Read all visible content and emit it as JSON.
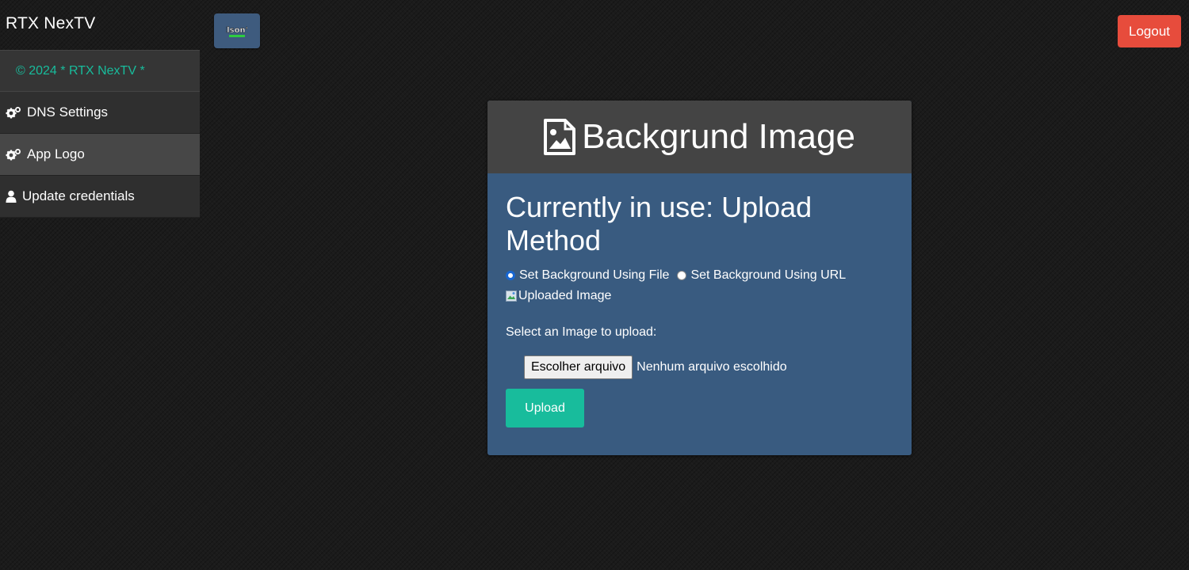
{
  "header": {
    "brand": "RTX NexTV",
    "logo_alt": "Elson's",
    "logout_label": "Logout"
  },
  "sidebar": {
    "copyright": "©  2024 *  RTX NexTV  *",
    "items": [
      {
        "label": "DNS Settings",
        "icon": "gears-icon",
        "active": false
      },
      {
        "label": "App Logo",
        "icon": "gears-icon",
        "active": true
      },
      {
        "label": "Update credentials",
        "icon": "user-icon",
        "active": false
      }
    ]
  },
  "card": {
    "title": "Backgrund Image",
    "title_icon": "image-icon",
    "in_use": "Currently in use: Upload Method",
    "radio_file_label": "Set Background Using File",
    "radio_url_label": "Set Background Using URL",
    "radio_selected": "file",
    "uploaded_image_alt": "Uploaded Image",
    "select_label": "Select an Image to upload:",
    "file_button_label": "Escolher arquivo",
    "file_status": "Nenhum arquivo escolhido",
    "upload_label": "Upload"
  },
  "colors": {
    "accent": "#18bc9c",
    "danger": "#e74c3c",
    "card_body": "#395b80",
    "card_head": "#444444"
  }
}
